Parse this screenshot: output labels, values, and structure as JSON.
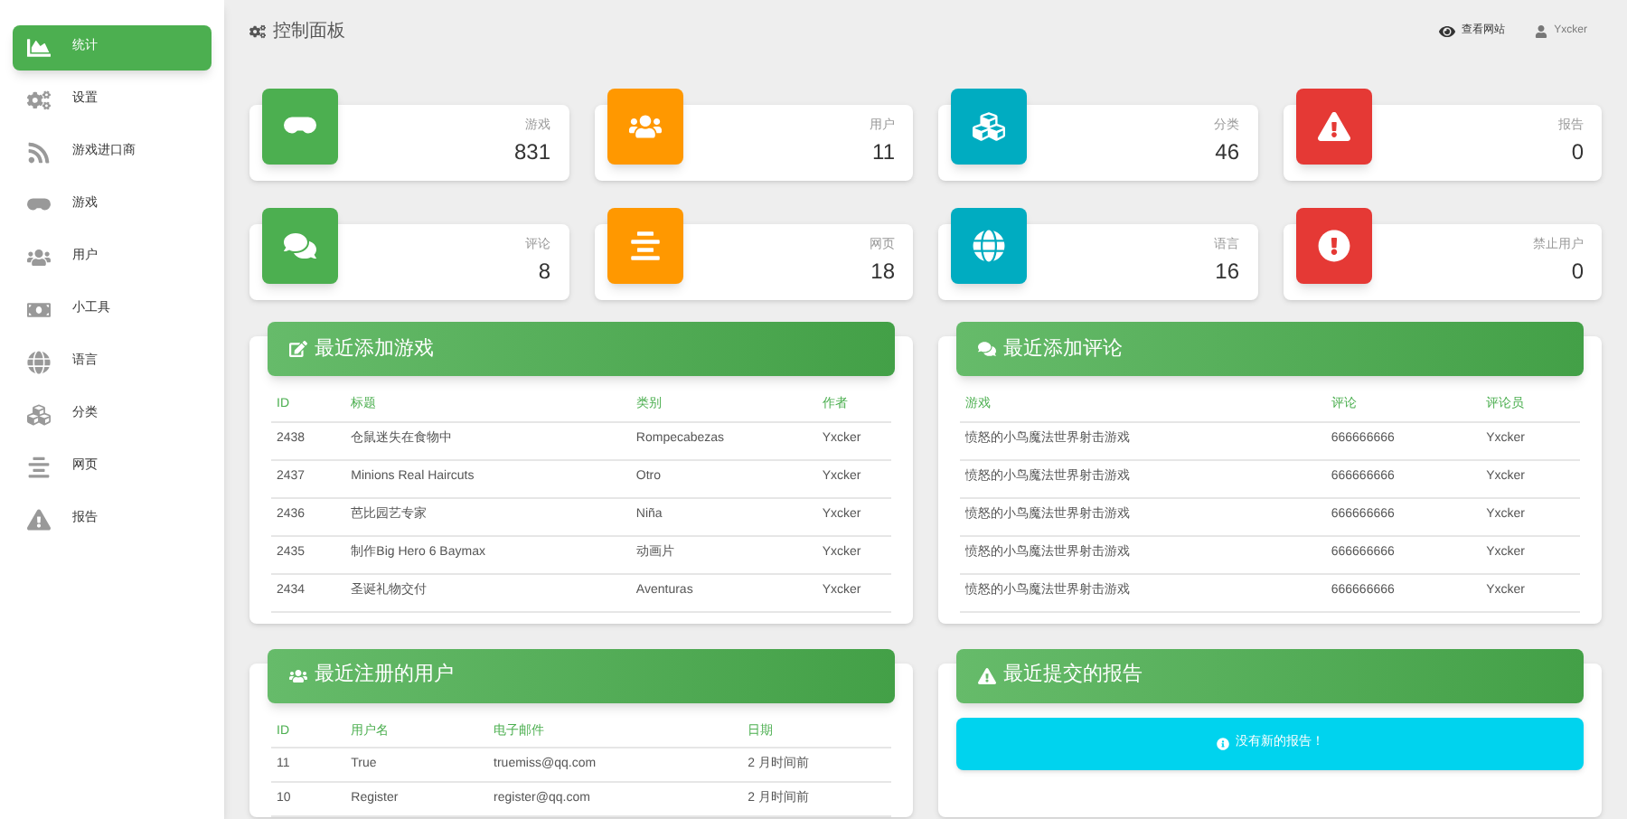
{
  "sidebar": {
    "items": [
      {
        "label": "统计",
        "selected": true
      },
      {
        "label": "设置",
        "selected": false
      },
      {
        "label": "游戏进口商",
        "selected": false
      },
      {
        "label": "游戏",
        "selected": false
      },
      {
        "label": "用户",
        "selected": false
      },
      {
        "label": "小工具",
        "selected": false
      },
      {
        "label": "语言",
        "selected": false
      },
      {
        "label": "分类",
        "selected": false
      },
      {
        "label": "网页",
        "selected": false
      },
      {
        "label": "报告",
        "selected": false
      }
    ]
  },
  "header": {
    "title": "控制面板",
    "view_site": "查看网站",
    "user": "Yxcker"
  },
  "stats": [
    {
      "label": "游戏",
      "value": "831",
      "color": "#4caf50"
    },
    {
      "label": "用户",
      "value": "11",
      "color": "#ff9800"
    },
    {
      "label": "分类",
      "value": "46",
      "color": "#00acc1"
    },
    {
      "label": "报告",
      "value": "0",
      "color": "#e53935"
    },
    {
      "label": "评论",
      "value": "8",
      "color": "#4caf50"
    },
    {
      "label": "网页",
      "value": "18",
      "color": "#ff9800"
    },
    {
      "label": "语言",
      "value": "16",
      "color": "#00acc1"
    },
    {
      "label": "禁止用户",
      "value": "0",
      "color": "#e53935"
    }
  ],
  "panels": [
    {
      "kind": "table",
      "title": "最近添加游戏",
      "columns": [
        "ID",
        "标题",
        "类别",
        "作者"
      ],
      "rows": [
        [
          "2438",
          "仓鼠迷失在食物中",
          "Rompecabezas",
          "Yxcker"
        ],
        [
          "2437",
          "Minions Real Haircuts",
          "Otro",
          "Yxcker"
        ],
        [
          "2436",
          "芭比园艺专家",
          "Niña",
          "Yxcker"
        ],
        [
          "2435",
          "制作Big Hero 6 Baymax",
          "动画片",
          "Yxcker"
        ],
        [
          "2434",
          "圣诞礼物交付",
          "Aventuras",
          "Yxcker"
        ]
      ]
    },
    {
      "kind": "table",
      "title": "最近添加评论",
      "columns": [
        "游戏",
        "评论",
        "评论员"
      ],
      "rows": [
        [
          "愤怒的小鸟魔法世界射击游戏",
          "666666666",
          "Yxcker"
        ],
        [
          "愤怒的小鸟魔法世界射击游戏",
          "666666666",
          "Yxcker"
        ],
        [
          "愤怒的小鸟魔法世界射击游戏",
          "666666666",
          "Yxcker"
        ],
        [
          "愤怒的小鸟魔法世界射击游戏",
          "666666666",
          "Yxcker"
        ],
        [
          "愤怒的小鸟魔法世界射击游戏",
          "666666666",
          "Yxcker"
        ]
      ]
    },
    {
      "kind": "table",
      "title": "最近注册的用户",
      "columns": [
        "ID",
        "用户名",
        "电子邮件",
        "日期"
      ],
      "rows": [
        [
          "11",
          "True",
          "truemiss@qq.com",
          "2 月时间前"
        ],
        [
          "10",
          "Register",
          "register@qq.com",
          "2 月时间前"
        ]
      ]
    },
    {
      "kind": "notice",
      "title": "最近提交的报告",
      "message": "没有新的报告！"
    }
  ]
}
